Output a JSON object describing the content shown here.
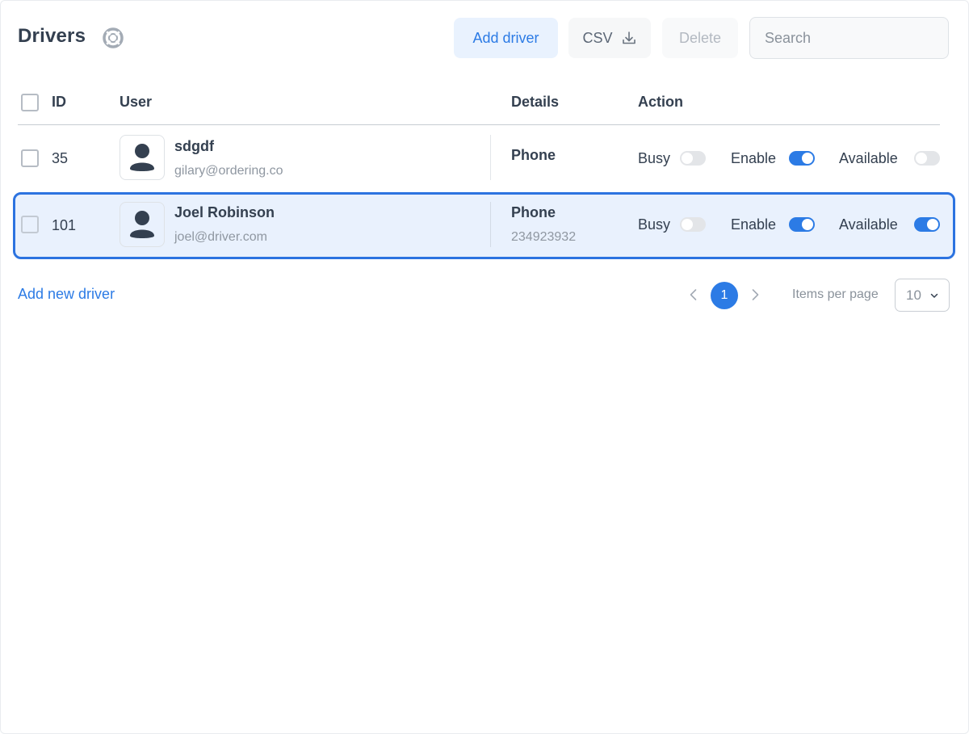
{
  "header": {
    "title": "Drivers",
    "add_label": "Add driver",
    "csv_label": "CSV",
    "delete_label": "Delete",
    "search_placeholder": "Search"
  },
  "table": {
    "columns": [
      "ID",
      "User",
      "Details",
      "Action"
    ],
    "rows": [
      {
        "id": "35",
        "name": "sdgdf",
        "email": "gilary@ordering.co",
        "detail_label": "Phone",
        "detail_value": "",
        "busy_label": "Busy",
        "busy": false,
        "enable_label": "Enable",
        "enable": true,
        "available_label": "Available",
        "available": false
      },
      {
        "id": "101",
        "name": "Joel Robinson",
        "email": "joel@driver.com",
        "detail_label": "Phone",
        "detail_value": "234923932",
        "busy_label": "Busy",
        "busy": false,
        "enable_label": "Enable",
        "enable": true,
        "available_label": "Available",
        "available": true
      }
    ]
  },
  "footer": {
    "add_new_label": "Add new driver",
    "current_page": "1",
    "items_per_page_label": "Items per page",
    "items_per_page_value": "10"
  },
  "colors": {
    "accent": "#2c7be5",
    "selected_row_border": "#2c73e0",
    "selected_row_bg": "#e9f1fd"
  }
}
